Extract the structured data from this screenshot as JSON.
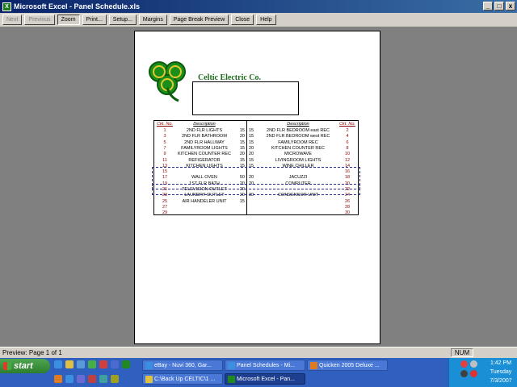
{
  "window": {
    "title": "Microsoft Excel - Panel Schedule.xls",
    "controls": [
      "_",
      "□",
      "x"
    ]
  },
  "toolbar": [
    "Next",
    "Previous",
    "Zoom",
    "Print...",
    "Setup...",
    "Margins",
    "Page Break Preview",
    "Close",
    "Help"
  ],
  "sheet": {
    "company": "Celtic Electric Co.",
    "headers": {
      "ckt_left": "Ckt. No.",
      "desc_left": "Description",
      "desc_right": "Description",
      "ckt_right": "Ckt. No."
    },
    "rows": [
      [
        "1",
        "2ND FLR LIGHTS",
        "15",
        "15",
        "2ND FLR BEDROOM east REC",
        "2"
      ],
      [
        "3",
        "2ND FLR BATHROOM",
        "20",
        "15",
        "2ND FLR BEDROOM west REC",
        "4"
      ],
      [
        "5",
        "2ND FLR HALLWAY",
        "15",
        "15",
        "FAMILYROOM REC",
        "6"
      ],
      [
        "7",
        "FAMILYROOM LIGHTS",
        "15",
        "20",
        "KITCHEN COUNTER REC",
        "8"
      ],
      [
        "9",
        "KITCHEN COUNTER REC",
        "20",
        "20",
        "MICROWAVE",
        "10"
      ],
      [
        "11",
        "REFIGERATOR",
        "15",
        "15",
        "LIVINGROOM LIGHTS",
        "12"
      ],
      [
        "13",
        "KITCHEN LIGHTS",
        "15",
        "15",
        "WINE CHILLER",
        "14"
      ],
      [
        "15",
        "",
        "",
        "",
        "",
        "16"
      ],
      [
        "17",
        "WALL OVEN",
        "50",
        "20",
        "JACUZZI",
        "18"
      ],
      [
        "19",
        "1ST FLR BATH",
        "20",
        "20",
        "COMPUTER",
        "20"
      ],
      [
        "21",
        "TELEVISION OUTLET",
        "20",
        "",
        "",
        "22"
      ],
      [
        "23",
        "LAUNDRY OUTLET",
        "20",
        "30",
        "CONDENSOR UNIT",
        "24"
      ],
      [
        "25",
        "AIR HANDELER UNIT",
        "15",
        "",
        "",
        "26"
      ],
      [
        "27",
        "",
        "",
        "",
        "",
        "28"
      ],
      [
        "29",
        "",
        "",
        "",
        "",
        "30"
      ]
    ]
  },
  "status": {
    "text": "Preview: Page 1 of 1",
    "num": "NUM"
  },
  "taskbar": {
    "start": "start",
    "tasks_row1": [
      "eBay - Nuvi 360, Gar...",
      "Panel Schedules - Mi...",
      "Quicken 2005 Deluxe ..."
    ],
    "tasks_row2": [
      "C:\\Back Up CELTIC\\1 ...",
      "Microsoft Excel - Pan..."
    ],
    "clock": {
      "time": "1:42 PM",
      "day": "Tuesday",
      "date": "7/3/2007"
    }
  },
  "colors": {
    "title_gradient_start": "#0a246a",
    "shamrock_green": "#1a8f1a",
    "company_text": "#1a6b1a",
    "taskbar_blue": "#2f5fbf",
    "start_green": "#3c9a3c"
  }
}
